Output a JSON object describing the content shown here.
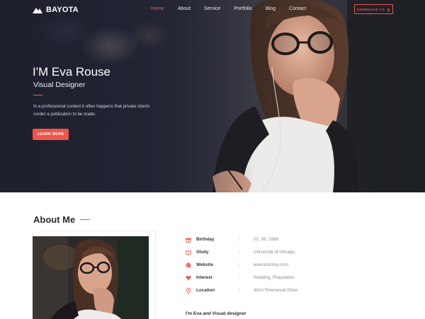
{
  "brand": {
    "name": "BAYOTA",
    "icon": "mountain-logo-icon"
  },
  "nav": {
    "items": [
      {
        "label": "Home",
        "active": true
      },
      {
        "label": "About",
        "active": false
      },
      {
        "label": "Service",
        "active": false
      },
      {
        "label": "Portfolio",
        "active": false
      },
      {
        "label": "Blog",
        "active": false
      },
      {
        "label": "Contact",
        "active": false
      }
    ],
    "cta_label": "DOWNLOAD CV"
  },
  "hero": {
    "title": "I'M Eva Rouse",
    "subtitle": "Visual Designer",
    "description": "In a professional context it often happens that private clients corder a publication to be made.",
    "button_label": "LEARN MORE"
  },
  "about": {
    "title": "About Me",
    "info": [
      {
        "icon": "gift-icon",
        "label": "Birthday",
        "value": "02. 06. 1988"
      },
      {
        "icon": "book-icon",
        "label": "Study",
        "value": "Univercity of chicago"
      },
      {
        "icon": "globe-icon",
        "label": "Website",
        "value": "www.dummy.com"
      },
      {
        "icon": "heart-icon",
        "label": "Interest",
        "value": "Reading, Playstation"
      },
      {
        "icon": "map-pin-icon",
        "label": "Location",
        "value": "4610 Riverwood Drive"
      }
    ],
    "intro": "I'm Eva and Visual designer"
  },
  "colors": {
    "accent": "#ef5549",
    "hero_bg": "#2a2c3b",
    "text_dark": "#2a2a33",
    "text_muted": "#8a8a93"
  }
}
